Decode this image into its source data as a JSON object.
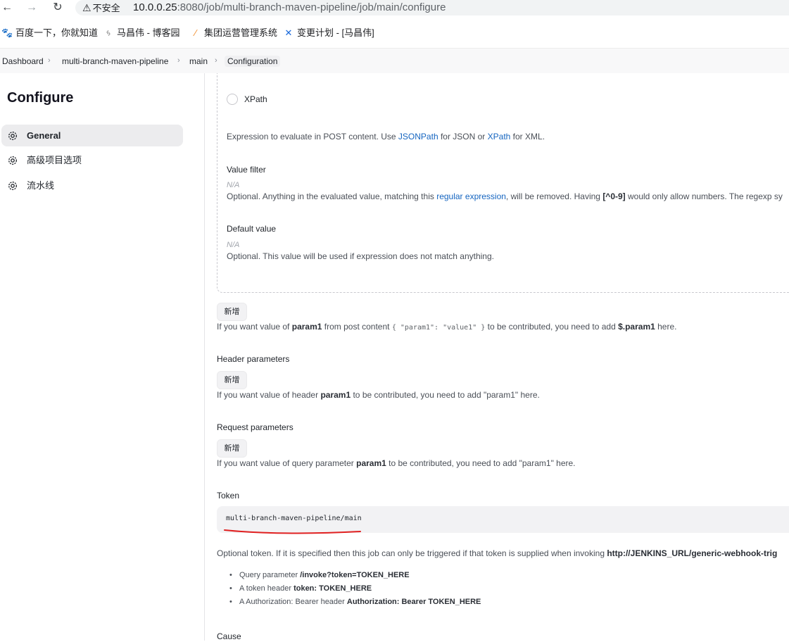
{
  "browser": {
    "back_icon": "←",
    "forward_icon": "→",
    "reload_icon": "↻",
    "insecure_label": "不安全",
    "url_host": "10.0.0.25",
    "url_rest": ":8080/job/multi-branch-maven-pipeline/job/main/configure",
    "bookmarks": [
      {
        "label": "百度一下，你就知道",
        "icon": "paw-icon"
      },
      {
        "label": "马昌伟 - 博客园",
        "icon": "cnblogs-icon"
      },
      {
        "label": "集团运营管理系统",
        "icon": "chart-icon"
      },
      {
        "label": "变更计划 - [马昌伟]",
        "icon": "confluence-icon"
      }
    ]
  },
  "breadcrumb": [
    {
      "label": "Dashboard"
    },
    {
      "label": "multi-branch-maven-pipeline"
    },
    {
      "label": "main"
    },
    {
      "label": "Configuration"
    }
  ],
  "sidebar": {
    "title": "Configure",
    "items": [
      {
        "label": "General",
        "active": true
      },
      {
        "label": "高级项目选项",
        "active": false
      },
      {
        "label": "流水线",
        "active": false
      }
    ]
  },
  "form": {
    "xpath_option": "XPath",
    "expression_help": {
      "pre": "Expression to evaluate in POST content. Use ",
      "jsonpath": "JSONPath",
      "mid": " for JSON or ",
      "xpath": "XPath",
      "post": " for XML."
    },
    "value_filter": {
      "label": "Value filter",
      "placeholder": "N/A",
      "help_pre": "Optional. Anything in the evaluated value, matching this ",
      "help_link": "regular expression",
      "help_mid": ", will be removed. Having ",
      "help_code": "[^0-9]",
      "help_post": " would only allow numbers. The regexp sy"
    },
    "default_value": {
      "label": "Default value",
      "placeholder": "N/A",
      "help": "Optional. This value will be used if expression does not match anything."
    },
    "add_label": "新增",
    "post_help": {
      "pre": "If you want value of ",
      "param": "param1",
      "mid": " from post content ",
      "code": "{ \"param1\": \"value1\" }",
      "mid2": " to be contributed, you need to add ",
      "expr": "$.param1",
      "post": " here."
    },
    "header_params": {
      "label": "Header parameters",
      "help_pre": "If you want value of header ",
      "param": "param1",
      "help_post": " to be contributed, you need to add \"param1\" here."
    },
    "request_params": {
      "label": "Request parameters",
      "help_pre": "If you want value of query parameter ",
      "param": "param1",
      "help_post": " to be contributed, you need to add \"param1\" here."
    },
    "token": {
      "label": "Token",
      "value": "multi-branch-maven-pipeline/main",
      "help_pre": "Optional token. If it is specified then this job can only be triggered if that token is supplied when invoking ",
      "help_url": "http://JENKINS_URL/generic-webhook-trig",
      "bullets": [
        {
          "pre": "Query parameter ",
          "bold": "/invoke?token=TOKEN_HERE"
        },
        {
          "pre": "A token header ",
          "bold": "token: TOKEN_HERE"
        },
        {
          "pre": "A Authorization: Bearer header ",
          "bold": "Authorization: Bearer TOKEN_HERE"
        }
      ]
    },
    "cause_label": "Cause"
  },
  "colors": {
    "link": "#1565c0",
    "annotation_underline": "#e02020"
  }
}
